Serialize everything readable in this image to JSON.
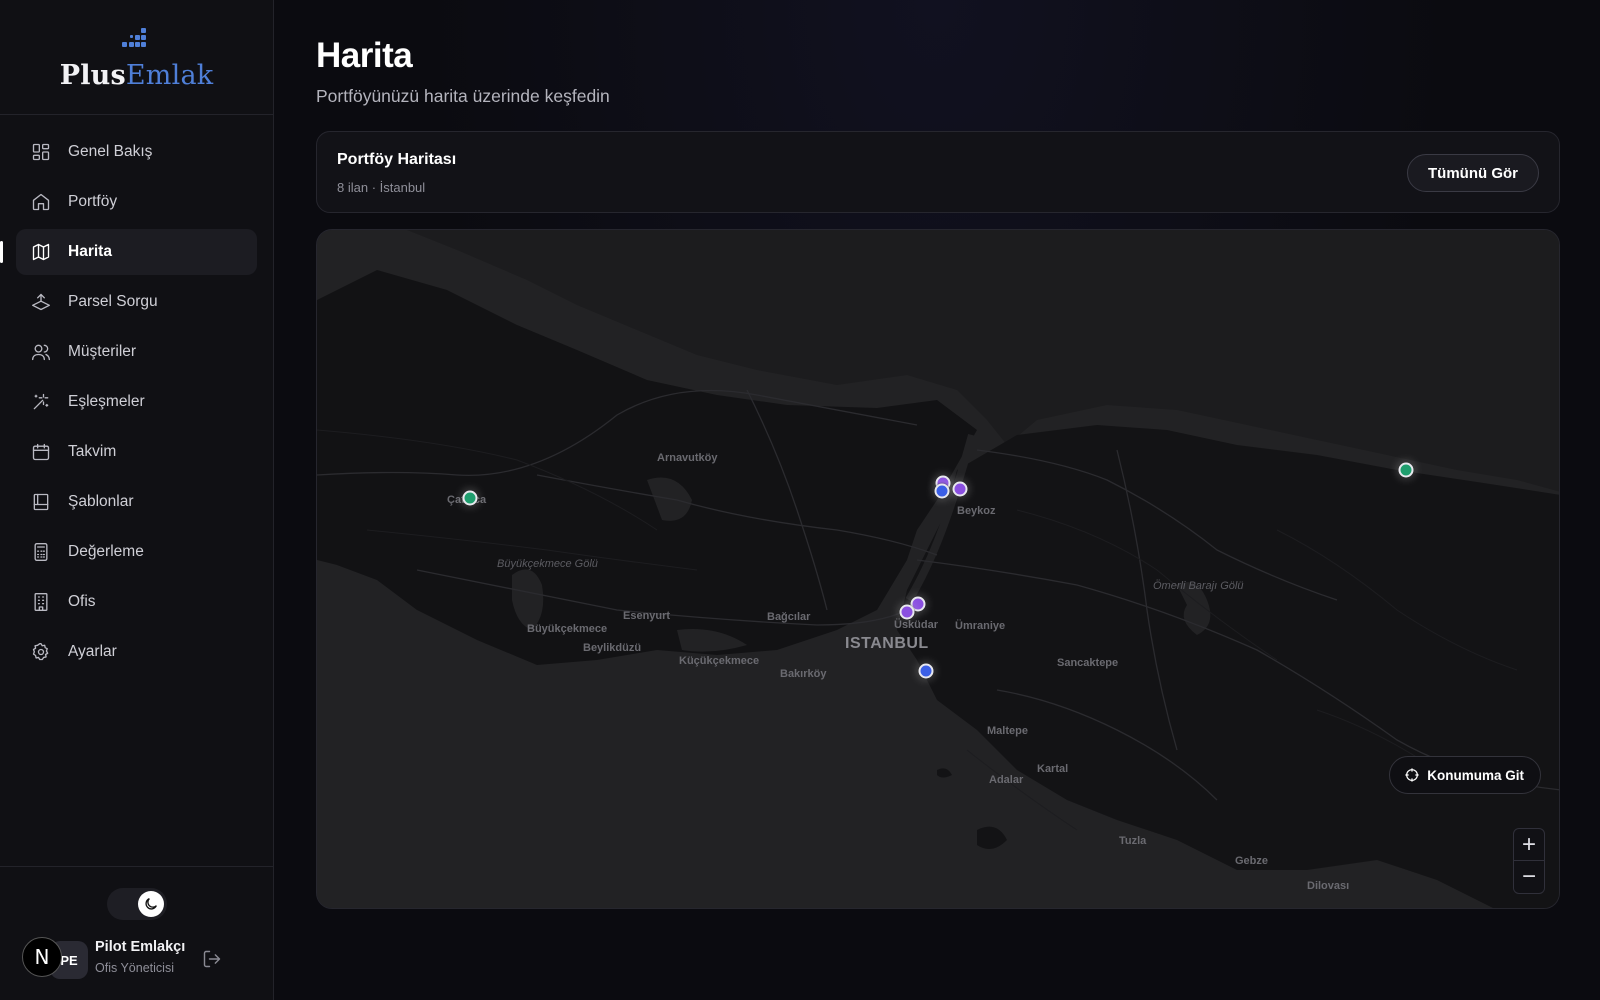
{
  "brand": {
    "part1": "Plus",
    "part2": "Emlak"
  },
  "sidebar": {
    "items": [
      {
        "label": "Genel Bakış",
        "icon": "dashboard-icon"
      },
      {
        "label": "Portföy",
        "icon": "home-icon"
      },
      {
        "label": "Harita",
        "icon": "map-icon",
        "active": true
      },
      {
        "label": "Parsel Sorgu",
        "icon": "parcel-icon"
      },
      {
        "label": "Müşteriler",
        "icon": "users-icon"
      },
      {
        "label": "Eşleşmeler",
        "icon": "sparkles-icon"
      },
      {
        "label": "Takvim",
        "icon": "calendar-icon"
      },
      {
        "label": "Şablonlar",
        "icon": "template-icon"
      },
      {
        "label": "Değerleme",
        "icon": "calculator-icon"
      },
      {
        "label": "Ofis",
        "icon": "building-icon"
      },
      {
        "label": "Ayarlar",
        "icon": "gear-icon"
      }
    ]
  },
  "user": {
    "name": "Pilot Emlakçı",
    "role": "Ofis Yöneticisi",
    "initials": "PE",
    "badge": "N"
  },
  "page": {
    "title": "Harita",
    "subtitle": "Portföyünüzü harita üzerinde keşfedin"
  },
  "card": {
    "title": "Portföy Haritası",
    "meta": "8 ilan · İstanbul",
    "view_all": "Tümünü Gör"
  },
  "map": {
    "locate_label": "Konumuma Git",
    "zoom_in": "+",
    "zoom_out": "−",
    "colors": {
      "green": "#1f9e6e",
      "purple": "#8a4fe0",
      "blue": "#3b5fe6"
    },
    "labels": {
      "arnavutkoy": "Arnavutköy",
      "catalca": "Çatalca",
      "beykoz": "Beykoz",
      "buyukcekmece_lake": "Büyükçekmece Gölü",
      "esenyurt": "Esenyurt",
      "bagcilar": "Bağcılar",
      "uskudar": "Üsküdar",
      "umraniye": "Ümraniye",
      "buyukcekmece": "Büyükçekmece",
      "beylikduzu": "Beylikdüzü",
      "istanbul": "ISTANBUL",
      "kucukcekmece": "Küçükçekmece",
      "bakirkoy": "Bakırköy",
      "sancaktepe": "Sancaktepe",
      "omerli": "Ömerli Barajı Gölü",
      "maltepe": "Maltepe",
      "kartal": "Kartal",
      "adalar": "Adalar",
      "tuzla": "Tuzla",
      "gebze": "Gebze",
      "dilovasi": "Dilovası"
    }
  }
}
